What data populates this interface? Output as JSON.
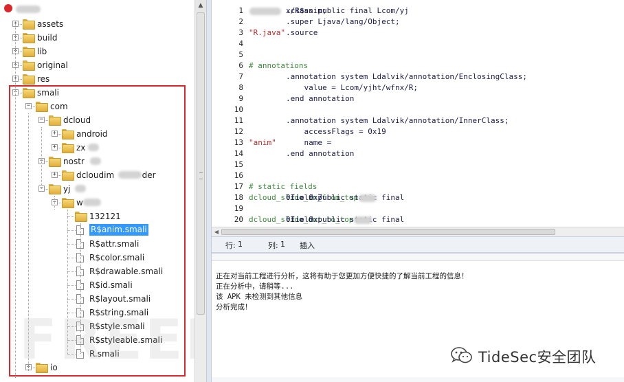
{
  "tree": {
    "items": [
      {
        "label": "assets",
        "kind": "folder",
        "expander": "+"
      },
      {
        "label": "build",
        "kind": "folder",
        "expander": "+"
      },
      {
        "label": "lib",
        "kind": "folder",
        "expander": "+"
      },
      {
        "label": "original",
        "kind": "folder",
        "expander": "+"
      },
      {
        "label": "res",
        "kind": "folder",
        "expander": "+"
      },
      {
        "label": "smali",
        "kind": "folder",
        "expander": "−"
      },
      {
        "label": "com",
        "kind": "folder",
        "expander": "−"
      },
      {
        "label": "dcloud",
        "kind": "folder",
        "expander": "−"
      },
      {
        "label": "android",
        "kind": "folder",
        "expander": "+"
      },
      {
        "label": "zx",
        "kind": "folder",
        "expander": "+"
      },
      {
        "label": "nostr",
        "kind": "folder",
        "expander": "−"
      },
      {
        "label": "dcloudim",
        "label_suffix": "der",
        "kind": "folder",
        "expander": "+"
      },
      {
        "label": "yj",
        "kind": "folder",
        "expander": "−"
      },
      {
        "label": "w",
        "kind": "folder",
        "expander": "−"
      },
      {
        "label": "132121",
        "kind": "folder",
        "expander": ""
      },
      {
        "label": "R$anim.smali",
        "kind": "file",
        "selected": true
      },
      {
        "label": "R$attr.smali",
        "kind": "file"
      },
      {
        "label": "R$color.smali",
        "kind": "file"
      },
      {
        "label": "R$drawable.smali",
        "kind": "file"
      },
      {
        "label": "R$id.smali",
        "kind": "file"
      },
      {
        "label": "R$layout.smali",
        "kind": "file"
      },
      {
        "label": "R$string.smali",
        "kind": "file"
      },
      {
        "label": "R$style.smali",
        "kind": "file"
      },
      {
        "label": "R$styleable.smali",
        "kind": "file"
      },
      {
        "label": "R.smali",
        "kind": "file"
      },
      {
        "label": "io",
        "kind": "folder",
        "expander": "+"
      }
    ]
  },
  "editor": {
    "lines": [
      {
        "n": "1",
        "segs": [
          {
            "t": ".class public final Lcom/yj",
            "c": "code"
          },
          {
            "t": "~~~~~~~",
            "c": "blur"
          },
          {
            "t": "x/R$anim;",
            "c": "code"
          }
        ]
      },
      {
        "n": "2",
        "segs": [
          {
            "t": ".super Ljava/lang/Object;",
            "c": "code"
          }
        ]
      },
      {
        "n": "3",
        "segs": [
          {
            "t": ".source ",
            "c": "code"
          },
          {
            "t": "\"R.java\"",
            "c": "str"
          }
        ]
      },
      {
        "n": "4",
        "segs": []
      },
      {
        "n": "5",
        "segs": []
      },
      {
        "n": "6",
        "segs": [
          {
            "t": "# annotations",
            "c": "cmt"
          }
        ]
      },
      {
        "n": "7",
        "segs": [
          {
            "t": ".annotation system Ldalvik/annotation/EnclosingClass;",
            "c": "code"
          }
        ]
      },
      {
        "n": "8",
        "segs": [
          {
            "t": "    value = Lcom/yjht/wfnx/R;",
            "c": "code"
          }
        ]
      },
      {
        "n": "9",
        "segs": [
          {
            "t": ".end annotation",
            "c": "code"
          }
        ]
      },
      {
        "n": "10",
        "segs": []
      },
      {
        "n": "11",
        "segs": [
          {
            "t": ".annotation system Ldalvik/annotation/InnerClass;",
            "c": "code"
          }
        ]
      },
      {
        "n": "12",
        "segs": [
          {
            "t": "    accessFlags = 0x19",
            "c": "code"
          }
        ]
      },
      {
        "n": "13",
        "segs": [
          {
            "t": "    name = ",
            "c": "code"
          },
          {
            "t": "\"anim\"",
            "c": "str"
          }
        ]
      },
      {
        "n": "14",
        "segs": [
          {
            "t": ".end annotation",
            "c": "code"
          }
        ]
      },
      {
        "n": "15",
        "segs": []
      },
      {
        "n": "16",
        "segs": []
      },
      {
        "n": "17",
        "segs": [
          {
            "t": "# static fields",
            "c": "cmt"
          }
        ]
      },
      {
        "n": "18",
        "segs": [
          {
            "t": ".field public static final ",
            "c": "code"
          },
          {
            "t": "dcloud_slide_in_from_top",
            "c": "fld"
          },
          {
            "t": ":I = 0x7",
            "c": "code"
          },
          {
            "t": "~~~~",
            "c": "blur"
          },
          {
            "t": "0",
            "c": "code"
          }
        ]
      },
      {
        "n": "19",
        "segs": []
      },
      {
        "n": "20",
        "segs": [
          {
            "t": ".field public static final ",
            "c": "code"
          },
          {
            "t": "dcloud_slide_out_to_top",
            "c": "fld"
          },
          {
            "t": ":I = 0x",
            "c": "code"
          },
          {
            "t": "~~~~",
            "c": "blur"
          },
          {
            "t": "01",
            "c": "code"
          }
        ]
      }
    ]
  },
  "statusbar": {
    "row_label": "行:",
    "row_value": "1",
    "col_label": "列:",
    "col_value": "1",
    "mode": "插入"
  },
  "output": {
    "lines": [
      "正在对当前工程进行分析，这将有助于您更加方便快捷的了解当前工程的信息！",
      "正在分析中，请稍等...",
      "该 APK 未检测到其他信息",
      "分析完成！"
    ]
  },
  "watermarks": {
    "left": "FREEBUF",
    "wechat": "TideSec安全团队"
  },
  "colors": {
    "selection": "#3399ff",
    "highlight_box": "#d9272b",
    "comment": "#3c8a3c",
    "string": "#c0282c"
  }
}
